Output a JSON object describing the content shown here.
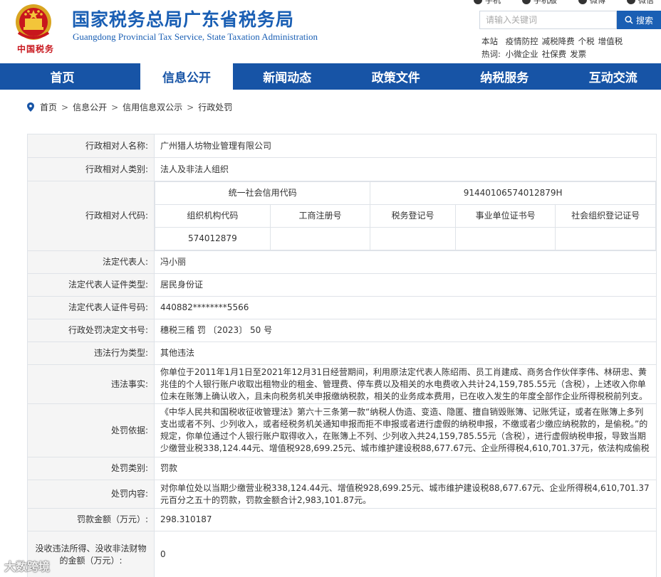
{
  "header": {
    "title_cn": "国家税务总局广东省税务局",
    "title_en": "Guangdong Provincial Tax Service, State Taxation Administration",
    "logo_text": "中国税务",
    "top_links": [
      "手机",
      "手机版",
      "微博",
      "微信"
    ],
    "search_placeholder": "请输入关键词",
    "search_button": "搜索",
    "hot_label": "本站热词:",
    "hot_words": [
      "疫情防控",
      "减税降费",
      "个税",
      "增值税",
      "小微企业",
      "社保费",
      "发票"
    ]
  },
  "nav": [
    "首页",
    "信息公开",
    "新闻动态",
    "政策文件",
    "纳税服务",
    "互动交流"
  ],
  "nav_active": 1,
  "breadcrumb": [
    "首页",
    "信息公开",
    "信用信息双公示",
    "行政处罚"
  ],
  "record": {
    "name_label": "行政相对人名称:",
    "name": "广州猎人坊物业管理有限公司",
    "type_label": "行政相对人类别:",
    "type": "法人及非法人组织",
    "code_label": "行政相对人代码:",
    "uscc_label": "统一社会信用代码",
    "uscc": "91440106574012879H",
    "org_code_label": "组织机构代码",
    "biz_reg_label": "工商注册号",
    "tax_reg_label": "税务登记号",
    "inst_cert_label": "事业单位证书号",
    "social_org_label": "社会组织登记证号",
    "org_code": "574012879",
    "biz_reg": "",
    "tax_reg": "",
    "inst_cert": "",
    "social_org": "",
    "legal_rep_label": "法定代表人:",
    "legal_rep": "冯小丽",
    "id_type_label": "法定代表人证件类型:",
    "id_type": "居民身份证",
    "id_no_label": "法定代表人证件号码:",
    "id_no": "440882********5566",
    "doc_no_label": "行政处罚决定文书号:",
    "doc_no": "穗税三稽 罚 〔2023〕 50 号",
    "violation_type_label": "违法行为类型:",
    "violation_type": "其他违法",
    "facts_label": "违法事实:",
    "facts": "你单位于2011年1月1日至2021年12月31日经营期间，利用原法定代表人陈绍雨、员工肖建成、商务合作伙伴李伟、林研忠、黄兆佳的个人银行账户收取出租物业的租金、管理费、停车费以及相关的水电费收入共计24,159,785.55元（含税），上述收入你单位未在账簿上确认收入，且未向税务机关申报缴纳税款，相关的业务成本费用，已在收入发生的年度全部作企业所得税税前列支。",
    "basis_label": "处罚依据:",
    "basis": "《中华人民共和国税收征收管理法》第六十三条第一款“纳税人伪造、变造、隐匿、擅自销毁账簿、记账凭证，或者在账簿上多列支出或者不列、少列收入，或者经税务机关通知申报而拒不申报或者进行虚假的纳税申报，不缴或者少缴应纳税款的，是偷税。”的规定，你单位通过个人银行账户取得收入，在账簿上不列、少列收入共24,159,785.55元（含税），进行虚假纳税申报，导致当期少缴营业税338,124.44元、增值税928,699.25元、城市维护建设税88,677.67元、企业所得税4,610,701.37元，依法构成偷税",
    "penalty_type_label": "处罚类别:",
    "penalty_type": "罚款",
    "penalty_content_label": "处罚内容:",
    "penalty_content": "对你单位处以当期少缴营业税338,124.44元、增值税928,699.25元、城市维护建设税88,677.67元、企业所得税4,610,701.37元百分之五十的罚款，罚款金额合计2,983,101.87元。",
    "fine_label": "罚款金额（万元）:",
    "fine": "298.310187",
    "confiscate_label": "没收违法所得、没收非法财物的金额（万元）:",
    "confiscate": "0"
  },
  "watermark": "大数跨境",
  "colors": {
    "brand": "#1754a6",
    "title": "#1a5fb4",
    "logo_red": "#c8161d"
  }
}
